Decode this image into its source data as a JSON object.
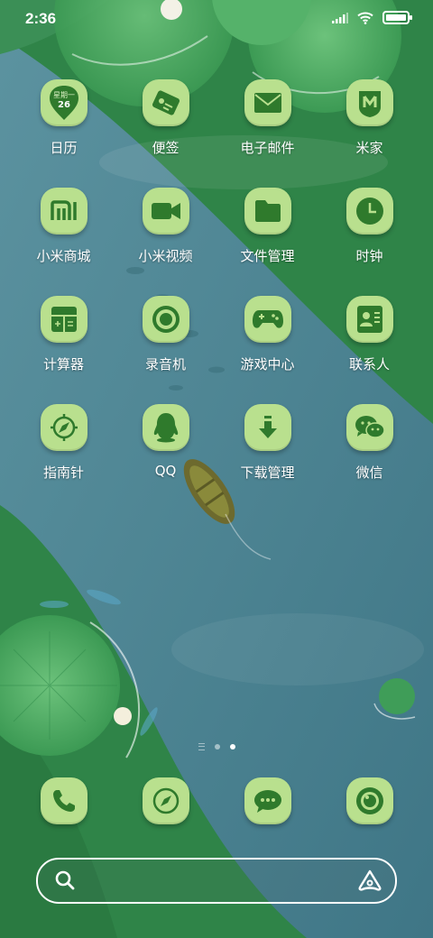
{
  "status": {
    "time": "2:36"
  },
  "calendar_icon": {
    "weekday": "星期一",
    "day": "26"
  },
  "apps": [
    {
      "label": "日历",
      "icon": "calendar-icon"
    },
    {
      "label": "便签",
      "icon": "notes-icon"
    },
    {
      "label": "电子邮件",
      "icon": "mail-icon"
    },
    {
      "label": "米家",
      "icon": "mijia-icon"
    },
    {
      "label": "小米商城",
      "icon": "mi-store-icon"
    },
    {
      "label": "小米视频",
      "icon": "video-icon"
    },
    {
      "label": "文件管理",
      "icon": "folder-icon"
    },
    {
      "label": "时钟",
      "icon": "clock-icon"
    },
    {
      "label": "计算器",
      "icon": "calculator-icon"
    },
    {
      "label": "录音机",
      "icon": "recorder-icon"
    },
    {
      "label": "游戏中心",
      "icon": "gamepad-icon"
    },
    {
      "label": "联系人",
      "icon": "contacts-icon"
    },
    {
      "label": "指南针",
      "icon": "compass-icon"
    },
    {
      "label": "QQ",
      "icon": "qq-icon"
    },
    {
      "label": "下载管理",
      "icon": "download-icon"
    },
    {
      "label": "微信",
      "icon": "wechat-icon"
    }
  ],
  "dock": [
    {
      "icon": "phone-icon"
    },
    {
      "icon": "browser-icon"
    },
    {
      "icon": "messages-icon"
    },
    {
      "icon": "camera-icon"
    }
  ],
  "pager": {
    "pages": 2,
    "active": 2
  },
  "colors": {
    "tile": "#b9e08e",
    "glyph": "#2f7a2c",
    "water": "#4f8591",
    "leaf": "#3d9a55"
  }
}
